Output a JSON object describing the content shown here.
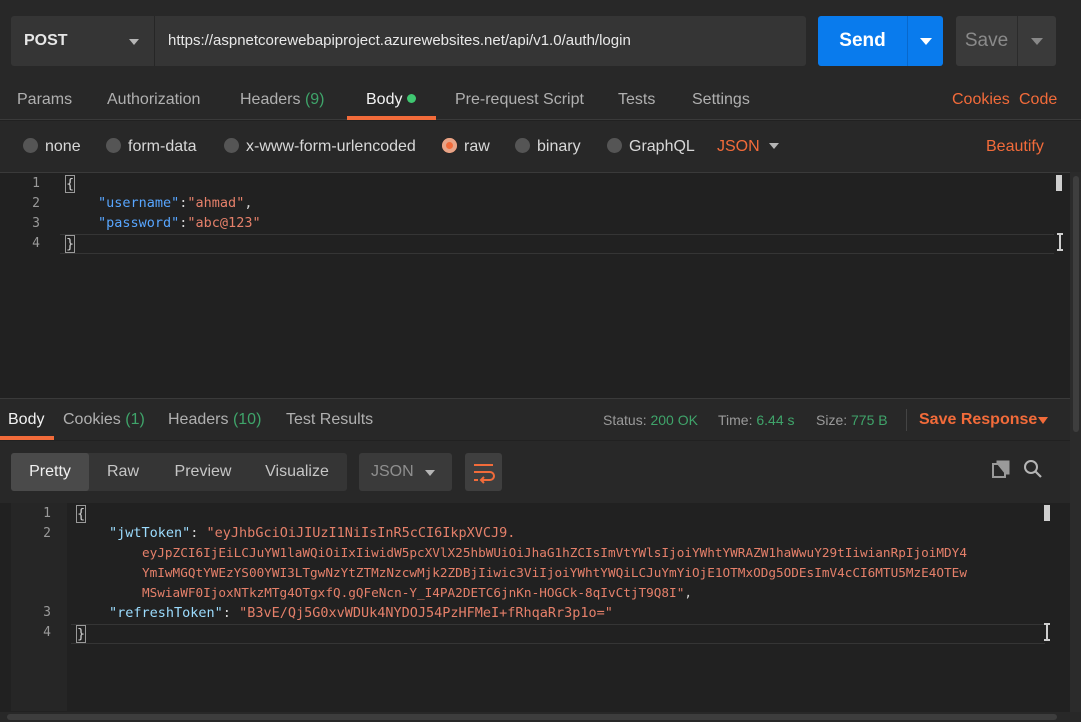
{
  "request": {
    "method": "POST",
    "url": "https://aspnetcorewebapiproject.azurewebsites.net/api/v1.0/auth/login",
    "send_label": "Send",
    "save_label": "Save"
  },
  "request_tabs": {
    "params": "Params",
    "authorization": "Authorization",
    "headers": "Headers",
    "headers_count": "(9)",
    "body": "Body",
    "prerequest": "Pre-request Script",
    "tests": "Tests",
    "settings": "Settings",
    "cookies": "Cookies",
    "code": "Code"
  },
  "body_types": {
    "none": "none",
    "form_data": "form-data",
    "urlencoded": "x-www-form-urlencoded",
    "raw": "raw",
    "binary": "binary",
    "graphql": "GraphQL",
    "selected": "raw",
    "format": "JSON",
    "beautify": "Beautify"
  },
  "request_body": {
    "line_numbers": [
      "1",
      "2",
      "3",
      "4"
    ],
    "open_brace": "{",
    "username_key": "\"username\"",
    "username_value": "\"ahmad\"",
    "password_key": "\"password\"",
    "password_value": "\"abc@123\"",
    "close_brace": "}"
  },
  "response_tabs": {
    "body": "Body",
    "cookies": "Cookies",
    "cookies_count": "(1)",
    "headers": "Headers",
    "headers_count": "(10)",
    "test_results": "Test Results"
  },
  "response_meta": {
    "status_label": "Status:",
    "status_value": "200 OK",
    "time_label": "Time:",
    "time_value": "6.44 s",
    "size_label": "Size:",
    "size_value": "775 B",
    "save_response": "Save Response"
  },
  "response_view": {
    "pretty": "Pretty",
    "raw": "Raw",
    "preview": "Preview",
    "visualize": "Visualize",
    "format": "JSON",
    "active": "Pretty"
  },
  "response_body": {
    "line_numbers": [
      "1",
      "2",
      "3",
      "4"
    ],
    "open_brace": "{",
    "jwt_key": "\"jwtToken\"",
    "jwt_value_1": "\"eyJhbGciOiJIUzI1NiIsInR5cCI6IkpXVCJ9.",
    "jwt_value_2": "eyJpZCI6IjEiLCJuYW1laWQiOiIxIiwidW5pcXVlX25hbWUiOiJhaG1hZCIsImVtYWlsIjoiYWhtYWRAZW1haWwuY29tIiwianRpIjoiMDY4",
    "jwt_value_3": "YmIwMGQtYWEzYS00YWI3LTgwNzYtZTMzNzcwMjk2ZDBjIiwic3ViIjoiYWhtYWQiLCJuYmYiOjE1OTMxODg5ODEsImV4cCI6MTU5MzE4OTEw",
    "jwt_value_4": "MSwiaWF0IjoxNTkzMTg4OTgxfQ.gQFeNcn-Y_I4PA2DETC6jnKn-HOGCk-8qIvCtjT9Q8I\"",
    "refresh_key": "\"refreshToken\"",
    "refresh_value": "\"B3vE/Qj5G0xvWDUk4NYDOJ54PzHFMeI+fRhqaRr3p1o=\"",
    "close_brace": "}"
  },
  "colors": {
    "accent_orange": "#f26b3a",
    "send_blue": "#097bed",
    "status_green": "#3fa46a"
  }
}
